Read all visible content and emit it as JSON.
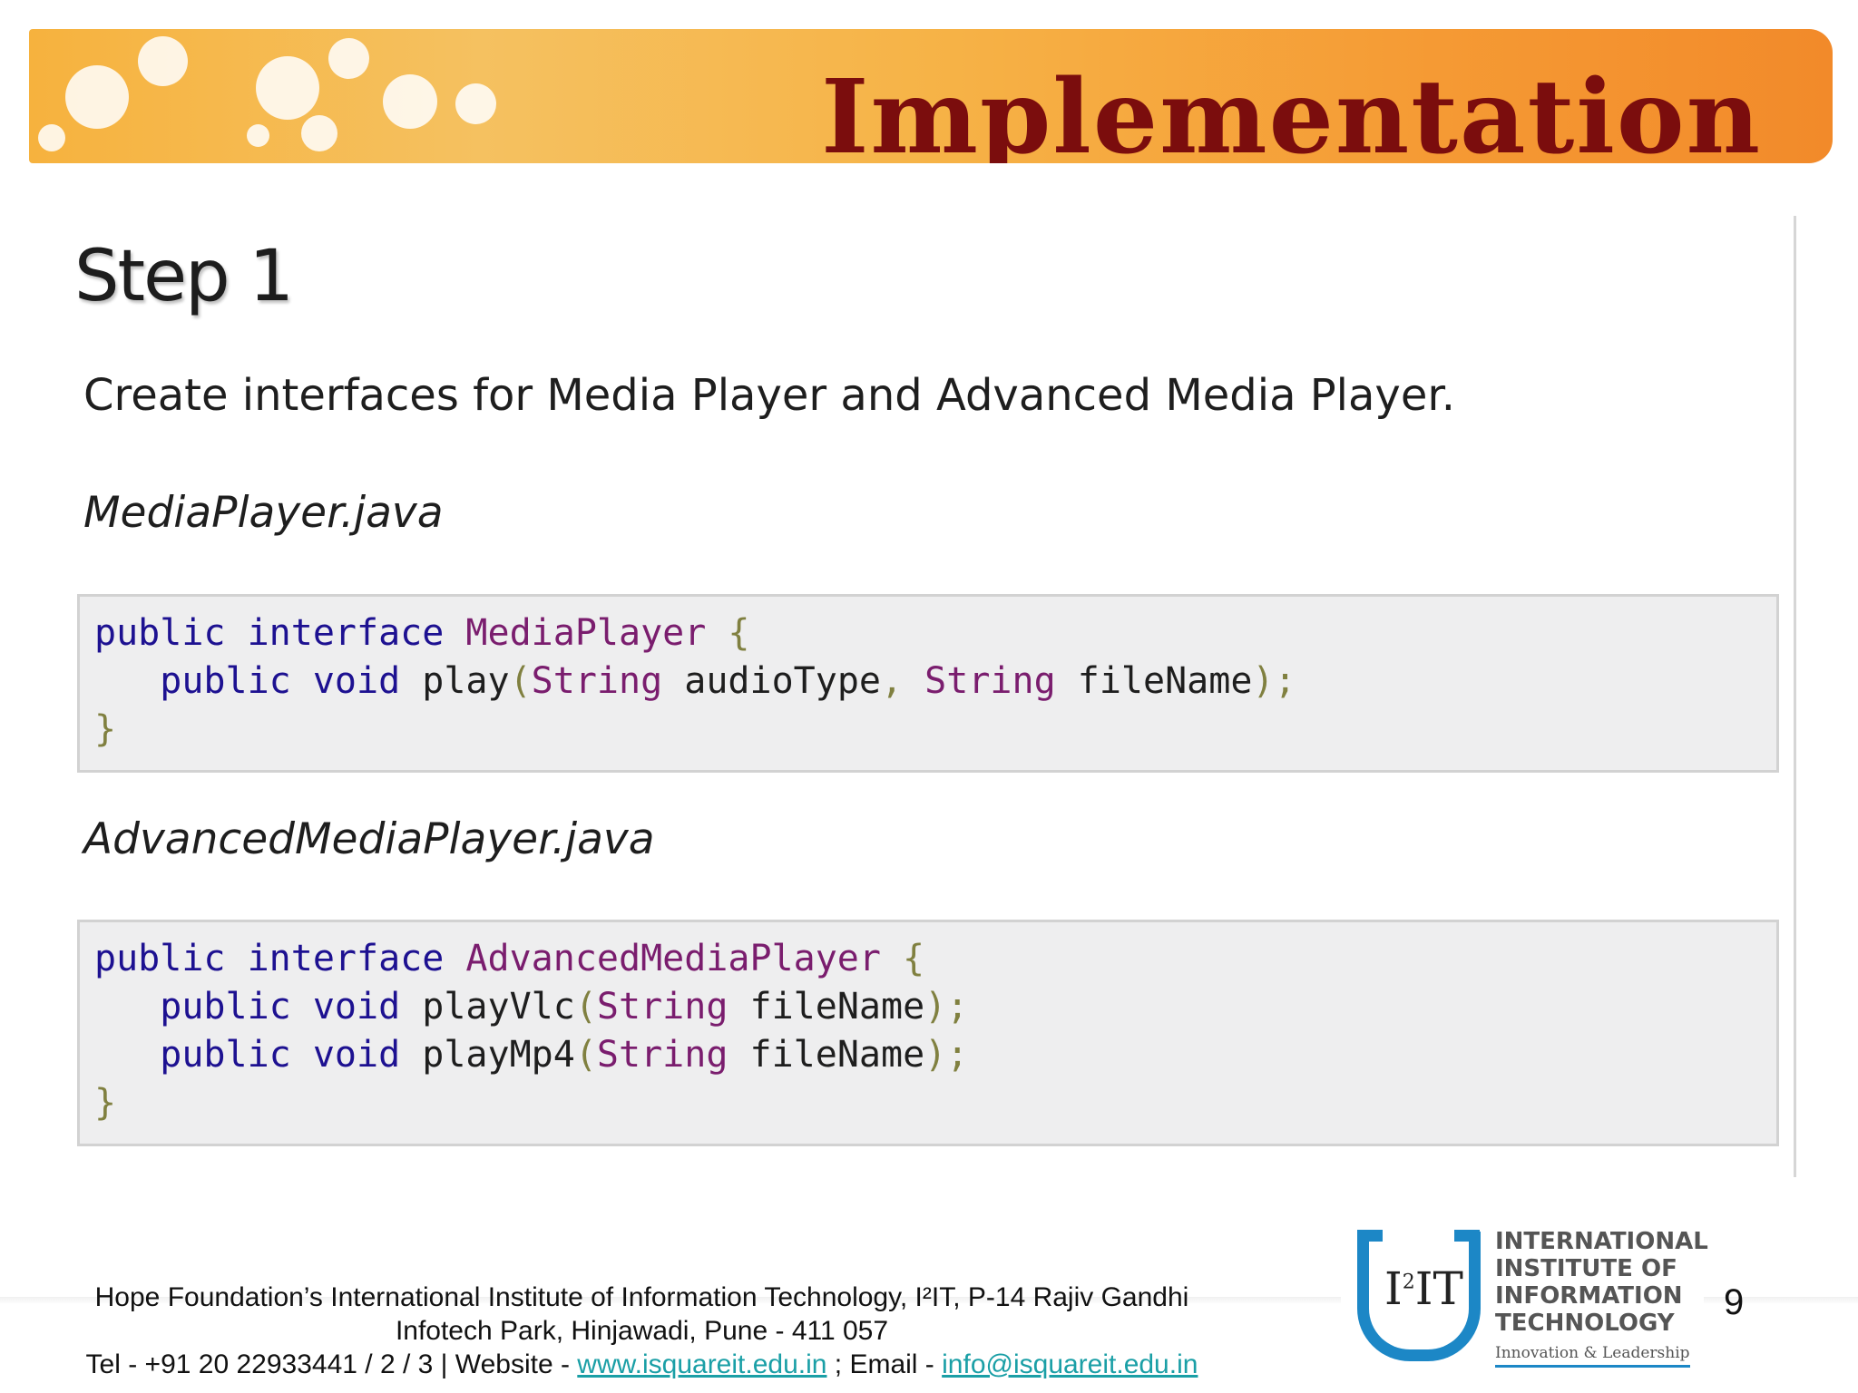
{
  "slide": {
    "title": "Implementation",
    "step_heading": "Step 1",
    "description": "Create interfaces for Media Player and Advanced Media Player.",
    "page_number": "9"
  },
  "files": [
    {
      "name": "MediaPlayer.java",
      "code": [
        [
          {
            "t": "public interface ",
            "k": "kw"
          },
          {
            "t": "MediaPlayer",
            "k": "ty"
          },
          {
            "t": " {",
            "k": "pn"
          }
        ],
        [
          {
            "t": "   public void ",
            "k": "kw"
          },
          {
            "t": "play",
            "k": ""
          },
          {
            "t": "(",
            "k": "pn"
          },
          {
            "t": "String",
            "k": "ty"
          },
          {
            "t": " audioType",
            "k": ""
          },
          {
            "t": ", ",
            "k": "pn"
          },
          {
            "t": "String",
            "k": "ty"
          },
          {
            "t": " fileName",
            "k": ""
          },
          {
            "t": ");",
            "k": "pn"
          }
        ],
        [
          {
            "t": "}",
            "k": "pn"
          }
        ]
      ]
    },
    {
      "name": "AdvancedMediaPlayer.java",
      "code": [
        [
          {
            "t": "public interface ",
            "k": "kw"
          },
          {
            "t": "AdvancedMediaPlayer",
            "k": "ty"
          },
          {
            "t": " {",
            "k": "pn"
          }
        ],
        [
          {
            "t": "   public void ",
            "k": "kw"
          },
          {
            "t": "playVlc",
            "k": ""
          },
          {
            "t": "(",
            "k": "pn"
          },
          {
            "t": "String",
            "k": "ty"
          },
          {
            "t": " fileName",
            "k": ""
          },
          {
            "t": ");",
            "k": "pn"
          }
        ],
        [
          {
            "t": "   public void ",
            "k": "kw"
          },
          {
            "t": "playMp4",
            "k": ""
          },
          {
            "t": "(",
            "k": "pn"
          },
          {
            "t": "String",
            "k": "ty"
          },
          {
            "t": " fileName",
            "k": ""
          },
          {
            "t": ");",
            "k": "pn"
          }
        ],
        [
          {
            "t": "}",
            "k": "pn"
          }
        ]
      ]
    }
  ],
  "footer": {
    "line1": "Hope Foundation’s International Institute of Information Technology, I²IT, P-14 Rajiv Gandhi",
    "line2": "Infotech Park, Hinjawadi, Pune - 411 057",
    "tel": "Tel - +91 20 22933441 / 2 / 3  |  Website - ",
    "website": "www.isquareit.edu.in",
    "email_label": " ; Email - ",
    "email": "info@isquareit.edu.in"
  },
  "logo": {
    "mark": "I",
    "mark_sup": "2",
    "mark_end": "IT",
    "lines": [
      "INTERNATIONAL",
      "INSTITUTE OF",
      "INFORMATION",
      "TECHNOLOGY"
    ],
    "tagline": "Innovation & Leadership"
  },
  "colors": {
    "title": "#7b0d0d",
    "keyword": "#1d1191",
    "type": "#7a1d6e",
    "punct": "#808040",
    "link": "#1a9fa6",
    "logo_blue": "#1c87c6"
  }
}
